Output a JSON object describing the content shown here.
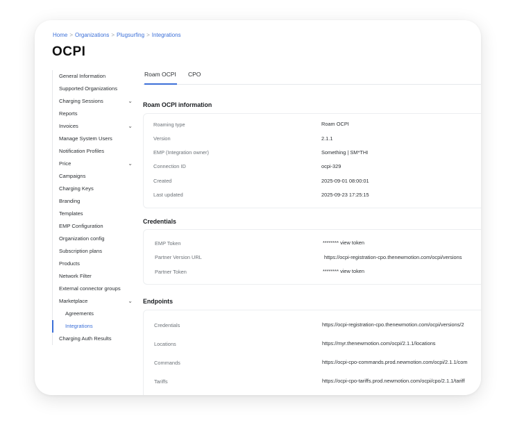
{
  "breadcrumb": [
    "Home",
    "Organizations",
    "Plugsurfing",
    "Integrations"
  ],
  "page_title": "OCPI",
  "sidebar": {
    "items": [
      {
        "label": "General Information"
      },
      {
        "label": "Supported Organizations"
      },
      {
        "label": "Charging Sessions",
        "chevron": "⌄"
      },
      {
        "label": "Reports"
      },
      {
        "label": "Invoices",
        "chevron": "⌄"
      },
      {
        "label": "Manage System Users"
      },
      {
        "label": "Notification Profiles"
      },
      {
        "label": "Price",
        "chevron": "⌄"
      },
      {
        "label": "Campaigns"
      },
      {
        "label": "Charging Keys"
      },
      {
        "label": "Branding"
      },
      {
        "label": "Templates"
      },
      {
        "label": "EMP Configuration"
      },
      {
        "label": "Organization config"
      },
      {
        "label": "Subscription plans"
      },
      {
        "label": "Products"
      },
      {
        "label": "Network Filter"
      },
      {
        "label": "External connector groups"
      },
      {
        "label": "Marketplace",
        "chevron": "⌄"
      },
      {
        "label": "Agreements"
      },
      {
        "label": "Integrations"
      },
      {
        "label": "Charging Auth Results"
      }
    ]
  },
  "tabs": [
    {
      "label": "Roam OCPI"
    },
    {
      "label": "CPO"
    }
  ],
  "info_section": {
    "title": "Roam OCPI information",
    "rows": [
      {
        "label": "Roaming type",
        "value": "Roam OCPI"
      },
      {
        "label": "Version",
        "value": "2.1.1"
      },
      {
        "label": "EMP (Integration owner)",
        "value": "Something | SM*THI"
      },
      {
        "label": "Connection ID",
        "value": "ocpi-329"
      },
      {
        "label": "Created",
        "value": "2025-09-01 08:00:01"
      },
      {
        "label": "Last updated",
        "value": "2025-09-23 17:25:15"
      }
    ]
  },
  "credentials_section": {
    "title": "Credentials",
    "rows": [
      {
        "label": "EMP Token",
        "value": "******** view token"
      },
      {
        "label": "Partner Version URL",
        "value": "https://ocpi-registration-cpo.thenewmotion.com/ocpi/versions"
      },
      {
        "label": "Partner Token",
        "value": "******** view token"
      }
    ]
  },
  "endpoints_section": {
    "title": "Endpoints",
    "rows": [
      {
        "label": "Credentials",
        "value": "https://ocpi-registration-cpo.thenewmotion.com/ocpi/versions/2"
      },
      {
        "label": "Locations",
        "value": "https://myr.thenewmotion.com/ocpi/2.1.1/locations"
      },
      {
        "label": "Commands",
        "value": "https://ocpi-cpo-commands.prod.newmotion.com/ocpi/2.1.1/com"
      },
      {
        "label": "Tariffs",
        "value": "https://ocpi-cpo-tariffs.prod.newmotion.com/ocpi/cpo/2.1.1/tariff"
      }
    ]
  }
}
